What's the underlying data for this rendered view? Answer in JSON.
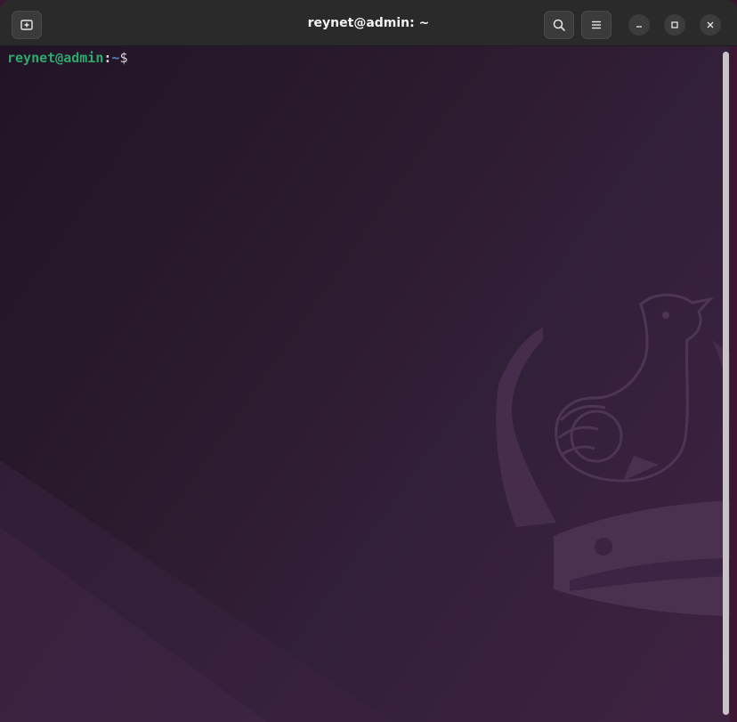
{
  "window": {
    "title": "reynet@admin: ~"
  },
  "toolbar": {
    "new_tab_icon": "new-tab-icon",
    "search_icon": "search-icon",
    "menu_icon": "hamburger-menu-icon"
  },
  "window_controls": {
    "minimize_icon": "minimize-icon",
    "maximize_icon": "maximize-icon",
    "close_icon": "close-icon"
  },
  "terminal": {
    "prompt_user_host": "reynet@admin",
    "prompt_colon": ":",
    "prompt_path": "~",
    "prompt_symbol": "$"
  },
  "colors": {
    "prompt_user": "#2fa86b",
    "prompt_path": "#5a7fc0",
    "titlebar": "#2a2a2a",
    "terminal_bg": "#2b1a2e"
  }
}
